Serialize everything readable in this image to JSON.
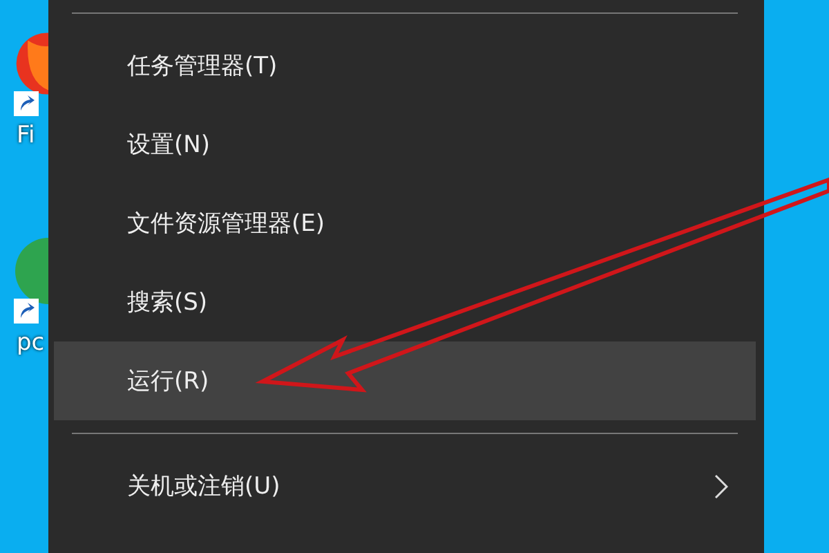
{
  "desktop_icons": [
    {
      "label": "Fi",
      "kind": "firefox"
    },
    {
      "label": "pc",
      "kind": "chrome"
    }
  ],
  "menu": {
    "groups": [
      [
        {
          "label": "任务管理器(T)",
          "selected": false,
          "submenu": false
        },
        {
          "label": "设置(N)",
          "selected": false,
          "submenu": false
        },
        {
          "label": "文件资源管理器(E)",
          "selected": false,
          "submenu": false
        },
        {
          "label": "搜索(S)",
          "selected": false,
          "submenu": false
        },
        {
          "label": "运行(R)",
          "selected": true,
          "submenu": false
        }
      ],
      [
        {
          "label": "关机或注销(U)",
          "selected": false,
          "submenu": true
        }
      ]
    ]
  }
}
